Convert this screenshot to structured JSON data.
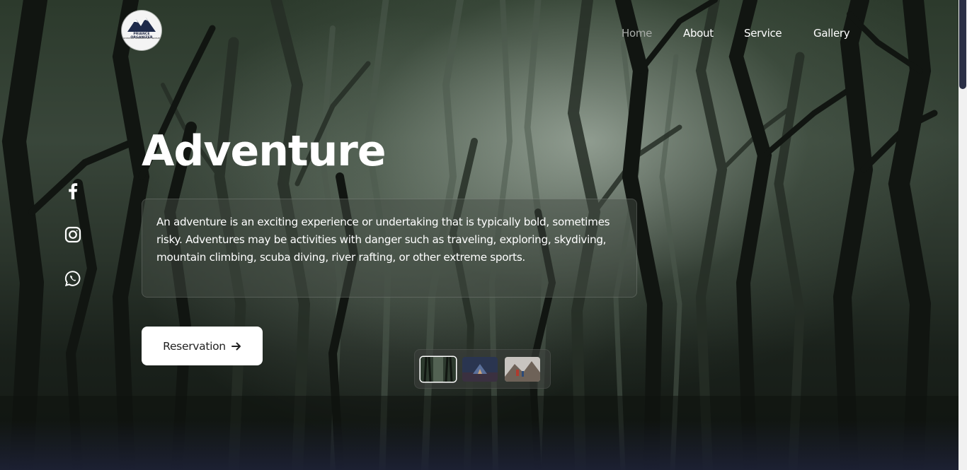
{
  "brand": {
    "logo_text": "PRIANCE ORGANIZER",
    "logo_subtext": "ADVENTURE ORGANIZER AND TRAVELER"
  },
  "nav": {
    "items": [
      {
        "label": "Home",
        "active": true
      },
      {
        "label": "About",
        "active": false
      },
      {
        "label": "Service",
        "active": false
      },
      {
        "label": "Gallery",
        "active": false
      }
    ]
  },
  "hero": {
    "title": "Adventure",
    "description": "An adventure is an exciting experience or undertaking that is typically bold, sometimes risky. Adventures may be activities with danger such as traveling, exploring, skydiving, mountain climbing, scuba diving, river rafting, or other extreme sports.",
    "cta_label": "Reservation",
    "cta_icon": "arrow-right-icon"
  },
  "social": [
    {
      "name": "facebook-icon"
    },
    {
      "name": "instagram-icon"
    },
    {
      "name": "whatsapp-icon"
    }
  ],
  "thumbnails": [
    {
      "name": "thumbnail-forest",
      "active": true
    },
    {
      "name": "thumbnail-camp",
      "active": false
    },
    {
      "name": "thumbnail-mountain",
      "active": false
    }
  ],
  "colors": {
    "nav_active": "#a8aca8",
    "text": "#ffffff",
    "button_bg": "#ffffff",
    "scrollbar_thumb": "#2a2f45"
  }
}
